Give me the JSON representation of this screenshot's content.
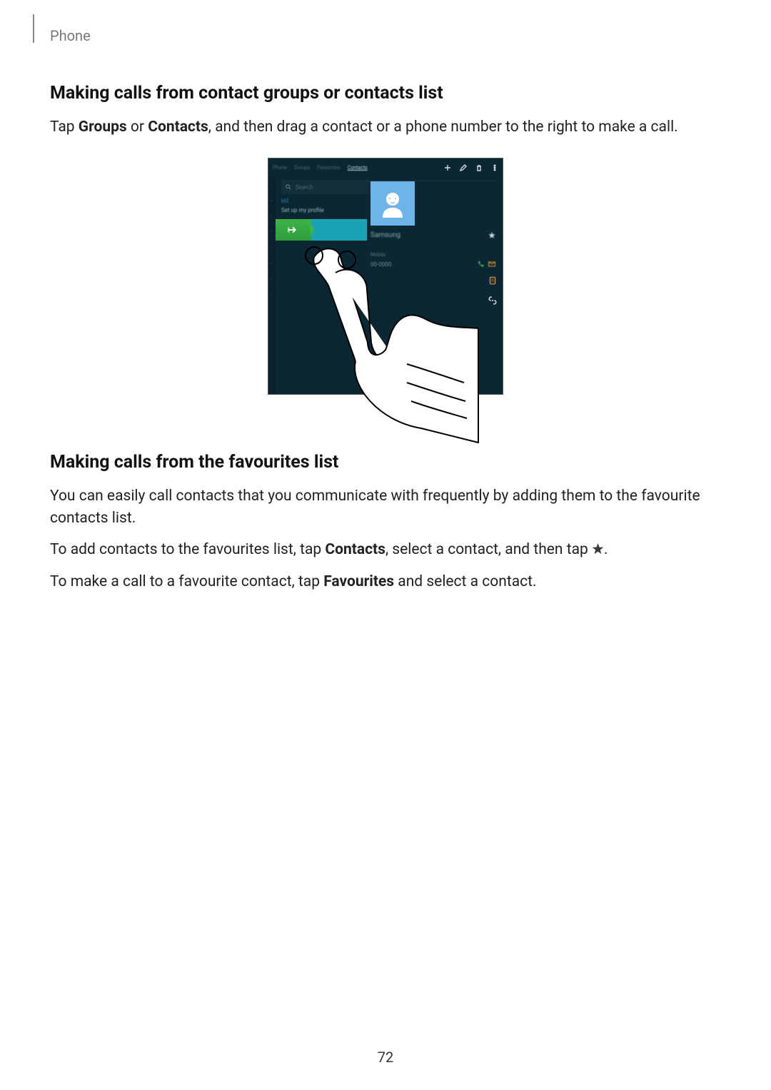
{
  "header": {
    "label": "Phone"
  },
  "section1": {
    "title": "Making calls from contact groups or contacts list",
    "para_pre": "Tap ",
    "bold1": "Groups",
    "mid1": " or ",
    "bold2": "Contacts",
    "para_post": ", and then drag a contact or a phone number to the right to make a call."
  },
  "illus": {
    "tabs": [
      "Phone",
      "Groups",
      "Favourites",
      "Contacts"
    ],
    "search_placeholder": "Search",
    "me_label": "ME",
    "setup_label": "Set up my profile",
    "contact_name": "Samsung",
    "phone_label": "Mobile",
    "phone_number": "00-0000"
  },
  "section2": {
    "title": "Making calls from the favourites list",
    "p1": "You can easily call contacts that you communicate with frequently by adding them to the favourite contacts list.",
    "p2_pre": "To add contacts to the favourites list, tap ",
    "p2_bold": "Contacts",
    "p2_mid": ", select a contact, and then tap ",
    "p2_post": ".",
    "p3_pre": "To make a call to a favourite contact, tap ",
    "p3_bold": "Favourites",
    "p3_post": " and select a contact."
  },
  "page_number": "72"
}
